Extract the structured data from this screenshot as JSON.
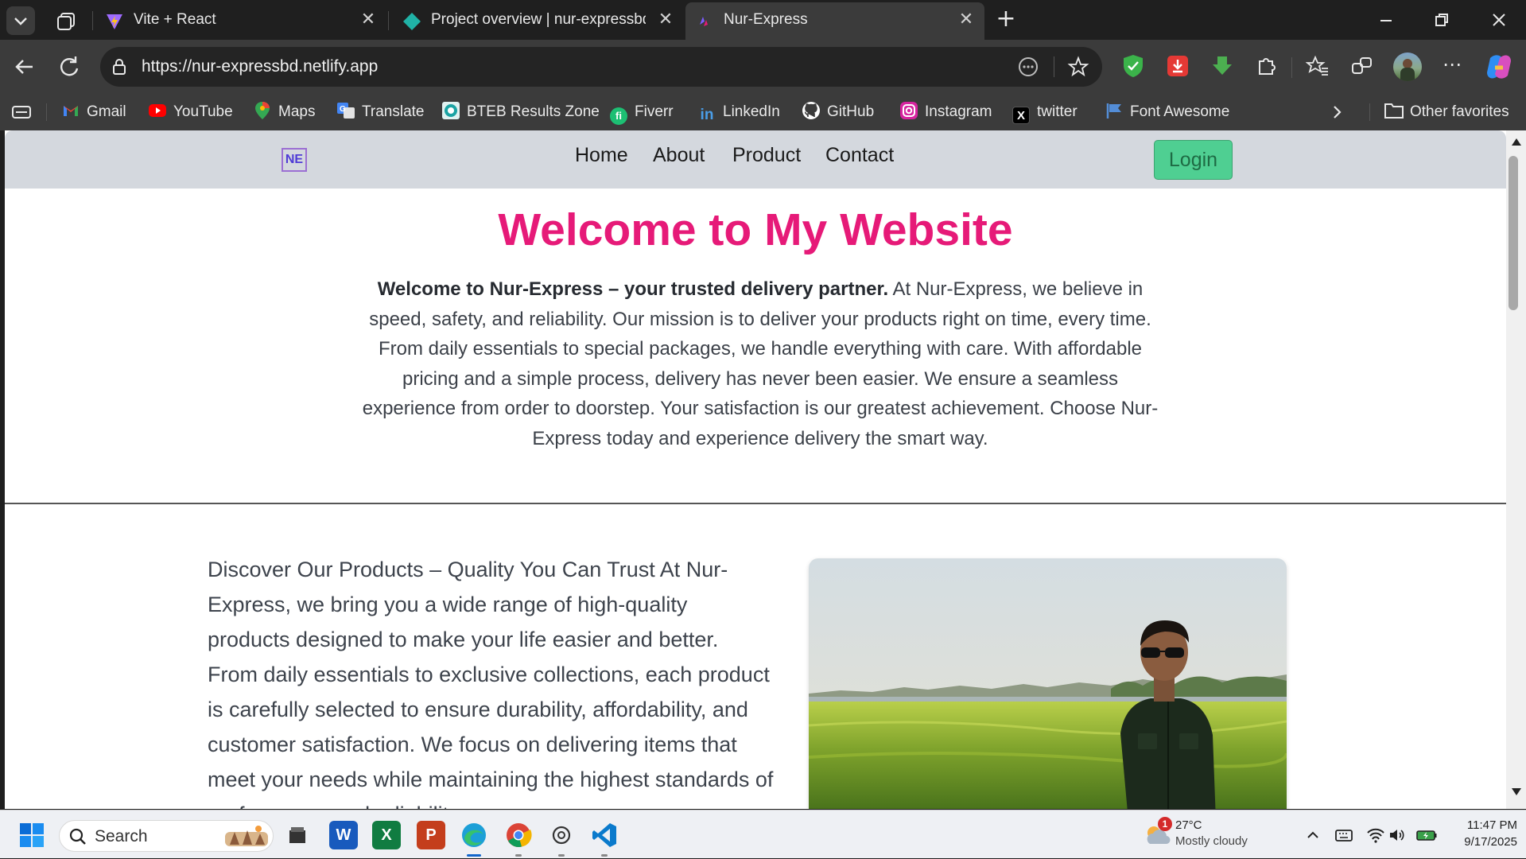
{
  "browser": {
    "tabs": [
      {
        "title": "Vite + React",
        "active": false
      },
      {
        "title": "Project overview | nur-expressbd",
        "active": false
      },
      {
        "title": "Nur-Express",
        "active": true
      }
    ],
    "url": "https://nur-expressbd.netlify.app",
    "favorites": [
      {
        "label": "Gmail",
        "icon": "gmail-icon",
        "color": "#ea4335"
      },
      {
        "label": "YouTube",
        "icon": "youtube-icon",
        "color": "#ff0000"
      },
      {
        "label": "Maps",
        "icon": "maps-icon",
        "color": "#34a853"
      },
      {
        "label": "Translate",
        "icon": "translate-icon",
        "color": "#4285f4"
      },
      {
        "label": "BTEB Results Zone",
        "icon": "bteb-icon",
        "color": "#1aa3a3"
      },
      {
        "label": "Fiverr",
        "icon": "fiverr-icon",
        "color": "#1dbf73"
      },
      {
        "label": "LinkedIn",
        "icon": "linkedin-icon",
        "color": "#0a66c2"
      },
      {
        "label": "GitHub",
        "icon": "github-icon",
        "color": "#ffffff"
      },
      {
        "label": "Instagram",
        "icon": "instagram-icon",
        "color": "#d6249f"
      },
      {
        "label": "twitter",
        "icon": "x-icon",
        "color": "#000000"
      },
      {
        "label": "Font Awesome",
        "icon": "font-awesome-icon",
        "color": "#538dd7"
      }
    ],
    "other_favorites": "Other favorites"
  },
  "site": {
    "logo_text": "NE",
    "nav": [
      "Home",
      "About",
      "Product",
      "Contact"
    ],
    "login": "Login",
    "hero_title": "Welcome to My Website",
    "hero_bold": "Welcome to Nur-Express – your trusted delivery partner.",
    "hero_body": " At Nur-Express, we believe in speed, safety, and reliability. Our mission is to deliver your products right on time, every time. From daily essentials to special packages, we handle everything with care. With affordable pricing and a simple process, delivery has never been easier. We ensure a seamless experience from order to doorstep. Your satisfaction is our greatest achievement. Choose Nur-Express today and experience delivery the smart way.",
    "products_text": "Discover Our Products – Quality You Can Trust At Nur-Express, we bring you a wide range of high-quality products designed to make your life easier and better. From daily essentials to exclusive collections, each product is carefully selected to ensure durability, affordability, and customer satisfaction. We focus on delivering items that meet your needs while maintaining the highest standards of performance and reliability.",
    "accent_color": "#e61a78",
    "login_color": "#4fcf92"
  },
  "taskbar": {
    "search_placeholder": "Search",
    "weather_temp": "27°C",
    "weather_desc": "Mostly cloudy",
    "weather_badge": "1",
    "time": "11:47 PM",
    "date": "9/17/2025",
    "apps": [
      "file-explorer-icon",
      "word-icon",
      "excel-icon",
      "powerpoint-icon",
      "edge-icon",
      "chrome-icon",
      "chatgpt-icon",
      "vscode-icon"
    ]
  }
}
